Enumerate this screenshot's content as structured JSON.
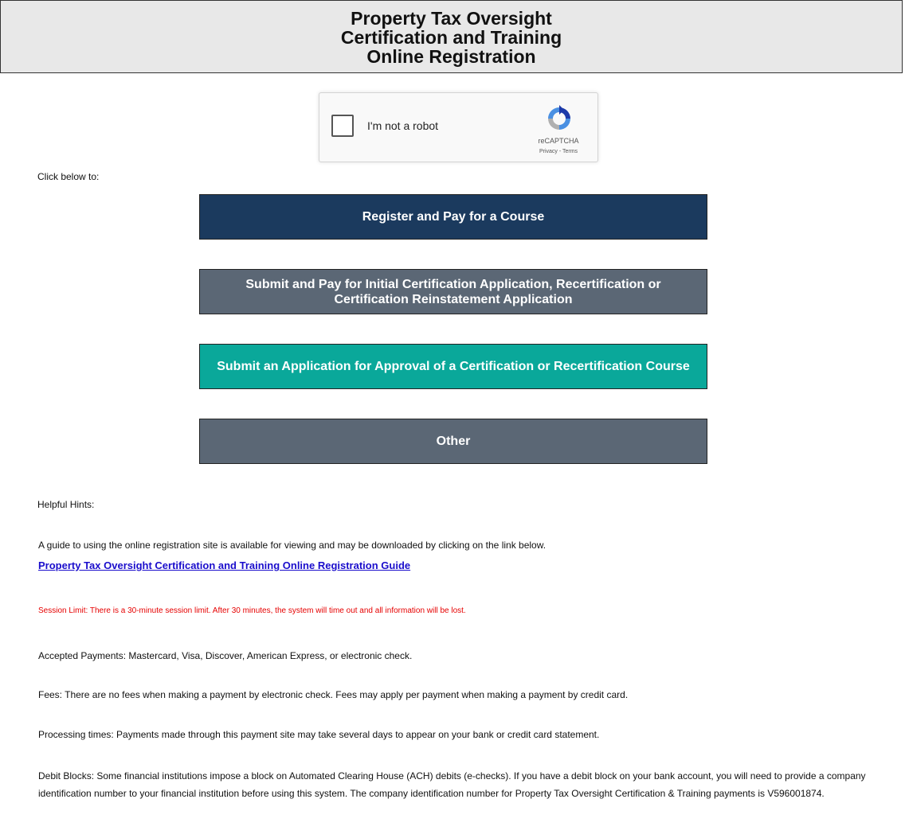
{
  "header": {
    "title_lines": [
      "Property Tax Oversight",
      "Certification and Training",
      "Online Registration"
    ]
  },
  "captcha": {
    "label": "I'm not a robot",
    "brand": "reCAPTCHA",
    "links": "Privacy - Terms",
    "icon": "recaptcha-logo-icon"
  },
  "intro": "Click below to:",
  "buttons": [
    {
      "label": "Register and Pay for a Course",
      "color": "#1b3a5e"
    },
    {
      "label": "Submit and Pay for Initial Certification Application, Recertification or Certification Reinstatement Application",
      "color": "#5b6775"
    },
    {
      "label": "Submit an Application for Approval of a Certification or Recertification Course",
      "color": "#0aa89a"
    },
    {
      "label": "Other",
      "color": "#5b6775"
    }
  ],
  "hints": {
    "title": "Helpful Hints:",
    "guide_text": "A guide to using the online registration site is available for viewing and may be downloaded by clicking on the link below.",
    "guide_link": "Property Tax Oversight Certification and Training Online Registration Guide",
    "session_limit": "Session Limit: There is a 30-minute session limit. After 30 minutes, the system will time out and all information will be lost.",
    "payments": "Accepted Payments: Mastercard, Visa, Discover, American Express, or electronic check.",
    "fees": "Fees: There are no fees when making a payment by electronic check. Fees may apply per payment when making a payment by credit card.",
    "processing": "Processing times: Payments made through this payment site may take several days to appear on your bank or credit card statement.",
    "debit_blocks": "Debit Blocks: Some financial institutions impose a block on Automated Clearing House (ACH) debits (e-checks). If you have a debit block on your bank account, you will need to provide a company identification number to your financial institution before using this system. The company identification number for Property Tax Oversight Certification & Training payments is V596001874."
  },
  "colors": {
    "session_red": "#e60000",
    "link_blue": "#1a0dcc"
  }
}
